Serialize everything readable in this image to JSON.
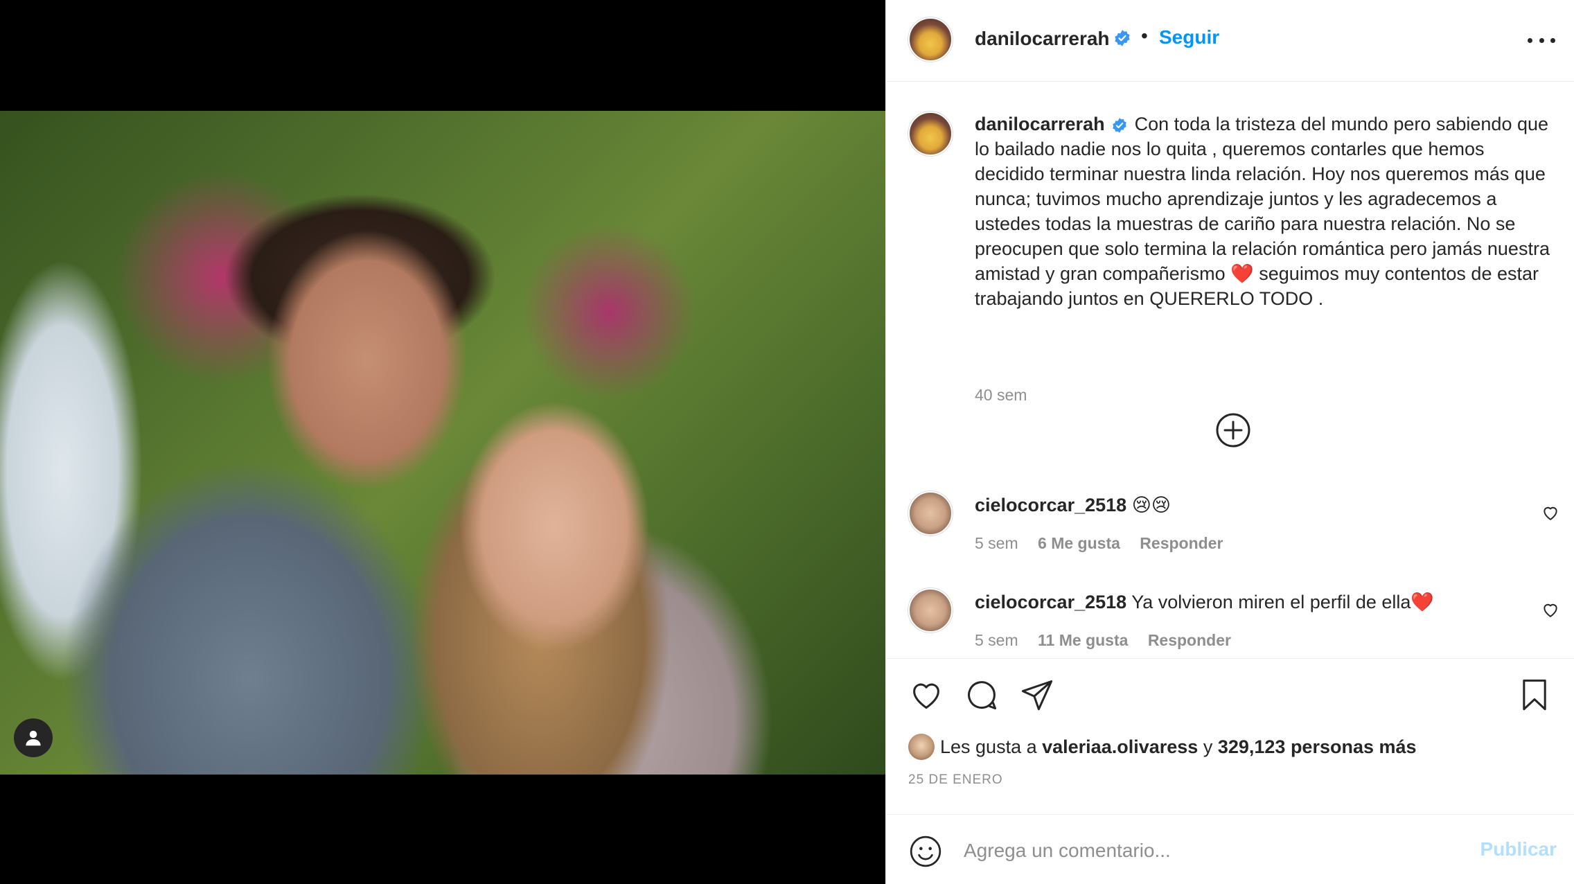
{
  "header": {
    "username": "danilocarrerah",
    "dot": "•",
    "follow_label": "Seguir"
  },
  "caption": {
    "username": "danilocarrerah",
    "text": "Con toda la tristeza del mundo pero sabiendo que lo bailado nadie nos lo quita , queremos contarles que hemos decidido terminar nuestra linda relación. Hoy nos queremos más que nunca; tuvimos mucho aprendizaje juntos y les agradecemos a ustedes todas la muestras de cariño para nuestra relación. No se preocupen que solo termina la relación romántica pero jamás nuestra amistad y gran compañerismo ❤️ seguimos muy contentos de estar trabajando juntos en QUERERLO TODO .",
    "time": "40 sem"
  },
  "comments": [
    {
      "username": "cielocorcar_2518",
      "text": "😢😢",
      "time": "5 sem",
      "likes": "6 Me gusta",
      "reply": "Responder"
    },
    {
      "username": "cielocorcar_2518",
      "text": "Ya volvieron miren el perfil de ella❤️",
      "time": "5 sem",
      "likes": "11 Me gusta",
      "reply": "Responder"
    }
  ],
  "likes": {
    "prefix": "Les gusta a",
    "user": "valeriaa.olivaress",
    "conj": "y",
    "count": "329,123 personas más"
  },
  "date": "25 DE ENERO",
  "add_comment": {
    "placeholder": "Agrega un comentario...",
    "publish_label": "Publicar"
  },
  "colors": {
    "accent": "#0095f6",
    "text": "#262626",
    "muted": "#8e8e8e",
    "publish_disabled": "#b2dffc",
    "verified": "#3897f0"
  },
  "icons": [
    "verified-badge-icon",
    "more-options-icon",
    "load-more-plus-icon",
    "heart-icon",
    "comment-icon",
    "share-icon",
    "bookmark-icon",
    "emoji-icon",
    "user-tag-icon"
  ]
}
